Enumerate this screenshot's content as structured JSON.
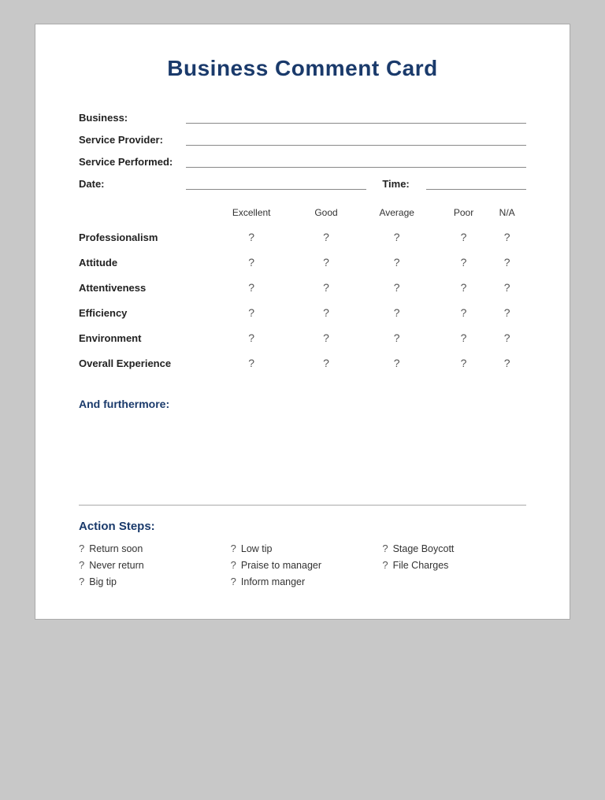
{
  "title": "Business Comment Card",
  "fields": {
    "business_label": "Business:",
    "service_provider_label": "Service Provider:",
    "service_performed_label": "Service Performed:",
    "date_label": "Date:",
    "time_label": "Time:"
  },
  "rating_headers": [
    "Excellent",
    "Good",
    "Average",
    "Poor",
    "N/A"
  ],
  "rating_rows": [
    "Professionalism",
    "Attitude",
    "Attentiveness",
    "Efficiency",
    "Environment",
    "Overall Experience"
  ],
  "furthermore_label": "And furthermore:",
  "divider": true,
  "action_steps_title": "Action Steps:",
  "action_steps": [
    {
      "col": 0,
      "label": "Return soon"
    },
    {
      "col": 1,
      "label": "Low tip"
    },
    {
      "col": 2,
      "label": "Stage Boycott"
    },
    {
      "col": 0,
      "label": "Never return"
    },
    {
      "col": 1,
      "label": "Praise to manager"
    },
    {
      "col": 2,
      "label": "File Charges"
    },
    {
      "col": 0,
      "label": "Big tip"
    },
    {
      "col": 1,
      "label": "Inform manger"
    }
  ],
  "q_mark": "?"
}
